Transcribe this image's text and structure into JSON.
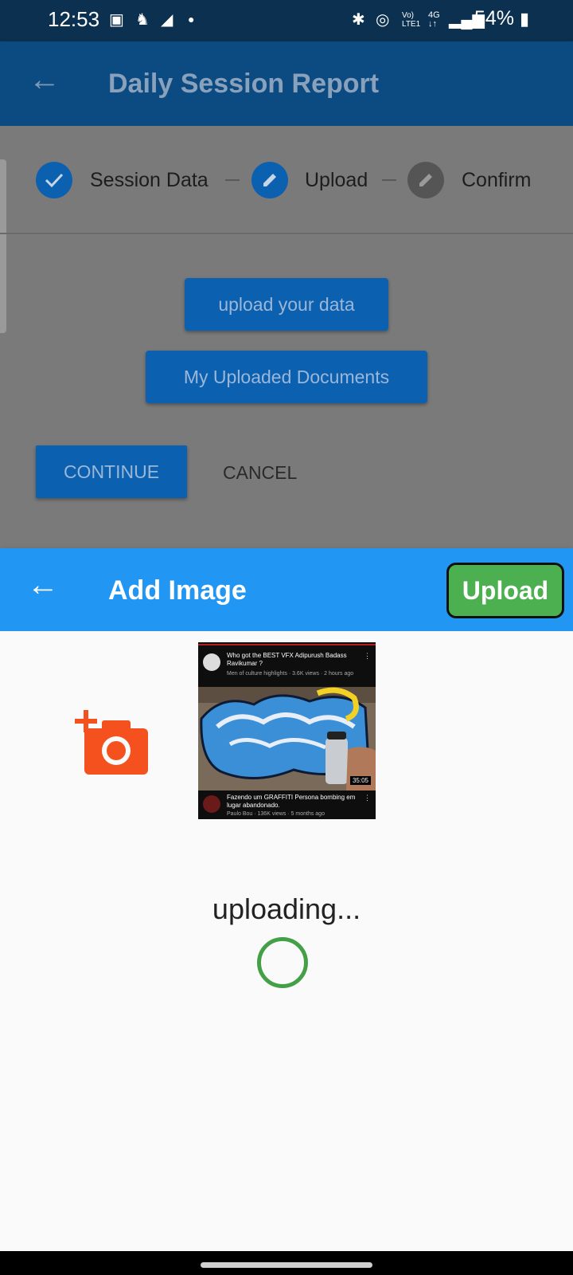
{
  "status_bar": {
    "time": "12:53",
    "battery": "54%"
  },
  "background_page": {
    "title": "Daily Session Report",
    "steps": [
      {
        "label": "Session Data",
        "state": "done"
      },
      {
        "label": "Upload",
        "state": "editing"
      },
      {
        "label": "Confirm",
        "state": "pending"
      }
    ],
    "upload_data_label": "upload your data",
    "my_documents_label": "My Uploaded Documents",
    "continue_label": "CONTINUE",
    "cancel_label": "CANCEL"
  },
  "sheet": {
    "title": "Add Image",
    "upload_label": "Upload",
    "thumbnail": {
      "video1_title": "Who got the BEST VFX Adipurush Badass Ravikumar ?",
      "video1_meta": "Men of culture highlights · 3.6K views · 2 hours ago",
      "duration": "35:05",
      "video2_title": "Fazendo um GRAFFITI Persona bombing em lugar abandonado.",
      "video2_meta": "Paulo Bou · 136K views · 5 months ago"
    },
    "uploading_text": "uploading..."
  },
  "colors": {
    "sheet_appbar": "#2296f3",
    "upload_button": "#4caf50",
    "add_photo_icon": "#f4511e",
    "spinner": "#43a047"
  }
}
